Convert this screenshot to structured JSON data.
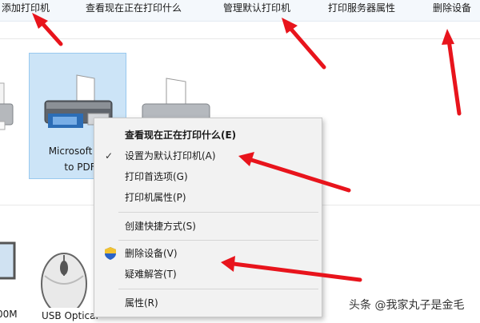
{
  "toolbar": {
    "add_printer": "添加打印机",
    "see_printing": "查看现在正在打印什么",
    "manage_default": "管理默认打印机",
    "print_server_props": "打印服务器属性",
    "remove_device": "删除设备"
  },
  "devices": {
    "selected_printer_line1": "Microsoft",
    "selected_printer_line2": "to PDF",
    "usb_device_label": "USB Optical",
    "left_partial_label": "00M"
  },
  "context_menu": {
    "items": [
      {
        "label": "查看现在正在打印什么(E)",
        "bold": true
      },
      {
        "label": "设置为默认打印机(A)",
        "checked": true
      },
      {
        "label": "打印首选项(G)"
      },
      {
        "label": "打印机属性(P)"
      },
      {
        "label": "创建快捷方式(S)"
      },
      {
        "label": "删除设备(V)",
        "icon": "uac-shield-icon"
      },
      {
        "label": "疑难解答(T)"
      },
      {
        "label": "属性(R)"
      }
    ]
  },
  "colors": {
    "selection": "#cce4f7",
    "arrow": "#e8141c",
    "menu_bg": "#f2f2f2"
  },
  "watermark": "头条 @我家丸子是金毛"
}
